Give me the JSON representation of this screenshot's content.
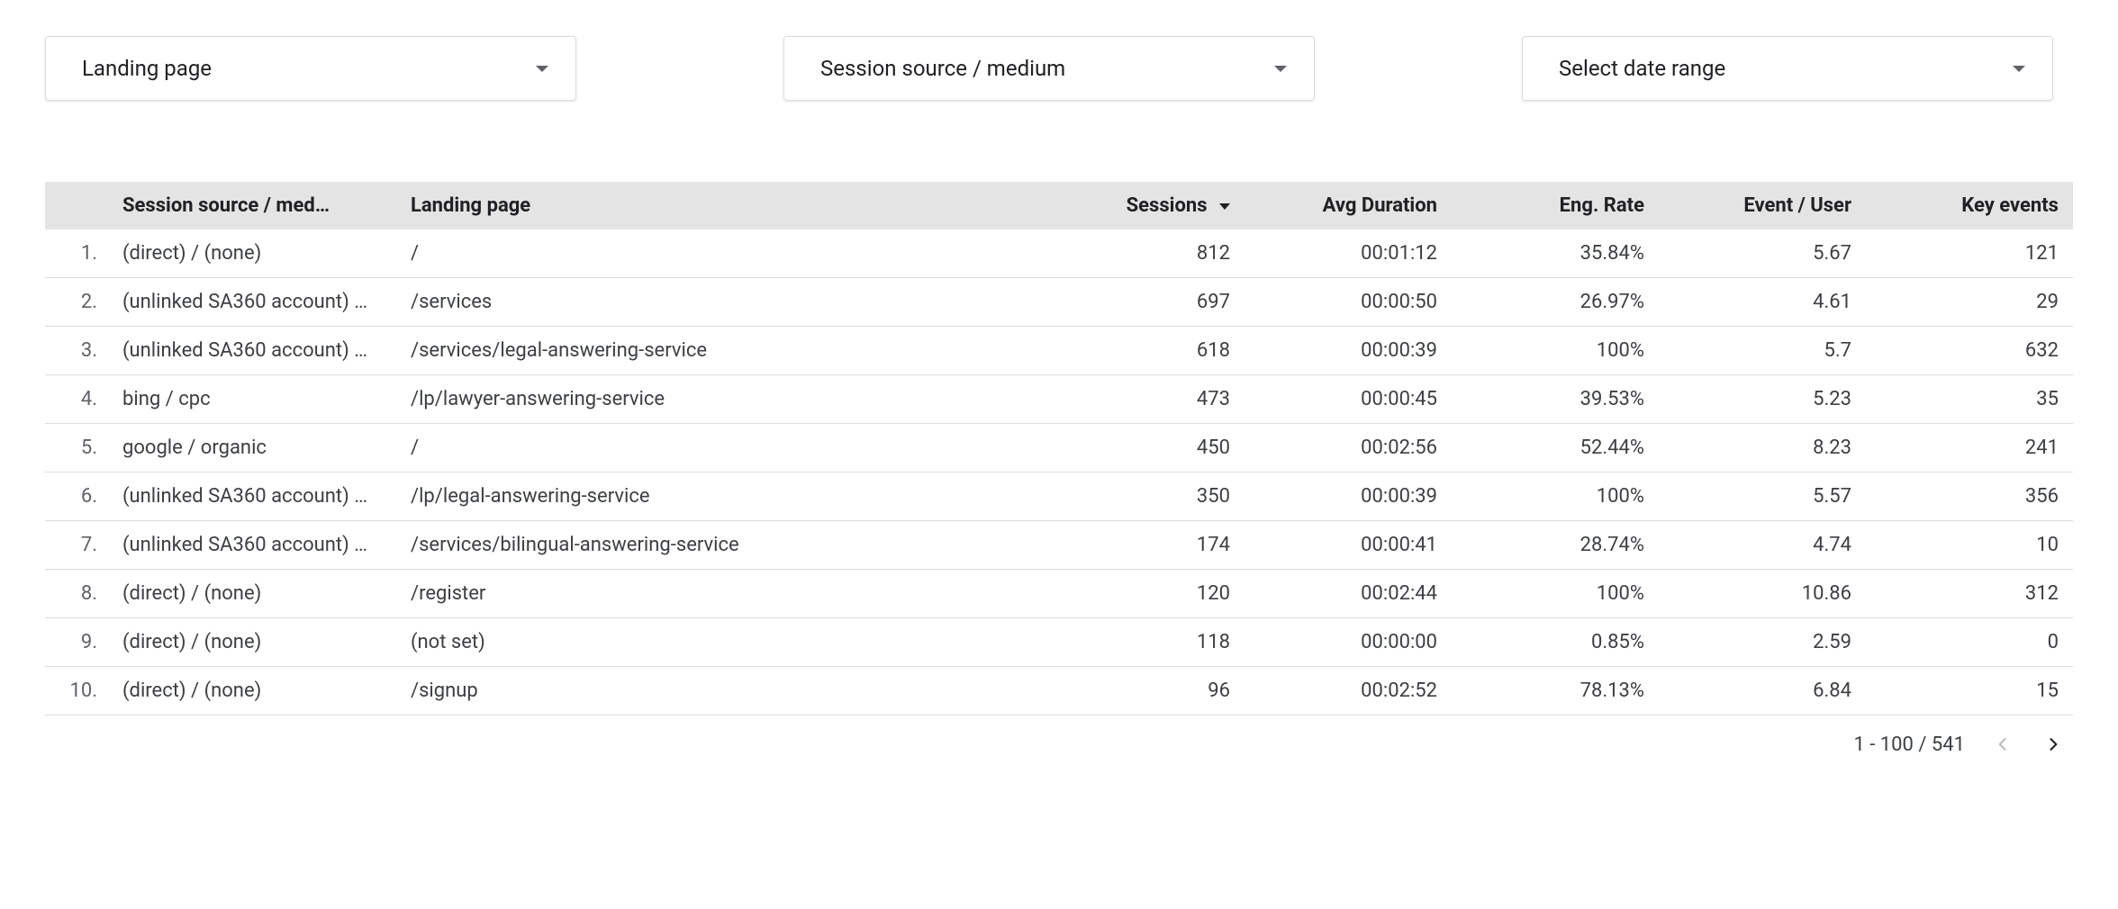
{
  "dropdowns": {
    "dimension1": "Landing page",
    "dimension2": "Session source / medium",
    "dateRange": "Select date range"
  },
  "table": {
    "headers": {
      "rowNum": "",
      "source": "Session source / med…",
      "landing": "Landing page",
      "sessions": "Sessions",
      "avgDuration": "Avg Duration",
      "engRate": "Eng. Rate",
      "eventUser": "Event / User",
      "keyEvents": "Key events"
    },
    "rows": [
      {
        "n": "1.",
        "source": "(direct) / (none)",
        "landing": "/",
        "sessions": "812",
        "avgDuration": "00:01:12",
        "engRate": "35.84%",
        "eventUser": "5.67",
        "keyEvents": "121"
      },
      {
        "n": "2.",
        "source": "(unlinked SA360 account) …",
        "landing": "/services",
        "sessions": "697",
        "avgDuration": "00:00:50",
        "engRate": "26.97%",
        "eventUser": "4.61",
        "keyEvents": "29"
      },
      {
        "n": "3.",
        "source": "(unlinked SA360 account) …",
        "landing": "/services/legal-answering-service",
        "sessions": "618",
        "avgDuration": "00:00:39",
        "engRate": "100%",
        "eventUser": "5.7",
        "keyEvents": "632"
      },
      {
        "n": "4.",
        "source": "bing / cpc",
        "landing": "/lp/lawyer-answering-service",
        "sessions": "473",
        "avgDuration": "00:00:45",
        "engRate": "39.53%",
        "eventUser": "5.23",
        "keyEvents": "35"
      },
      {
        "n": "5.",
        "source": "google / organic",
        "landing": "/",
        "sessions": "450",
        "avgDuration": "00:02:56",
        "engRate": "52.44%",
        "eventUser": "8.23",
        "keyEvents": "241"
      },
      {
        "n": "6.",
        "source": "(unlinked SA360 account) …",
        "landing": "/lp/legal-answering-service",
        "sessions": "350",
        "avgDuration": "00:00:39",
        "engRate": "100%",
        "eventUser": "5.57",
        "keyEvents": "356"
      },
      {
        "n": "7.",
        "source": "(unlinked SA360 account) …",
        "landing": "/services/bilingual-answering-service",
        "sessions": "174",
        "avgDuration": "00:00:41",
        "engRate": "28.74%",
        "eventUser": "4.74",
        "keyEvents": "10"
      },
      {
        "n": "8.",
        "source": "(direct) / (none)",
        "landing": "/register",
        "sessions": "120",
        "avgDuration": "00:02:44",
        "engRate": "100%",
        "eventUser": "10.86",
        "keyEvents": "312"
      },
      {
        "n": "9.",
        "source": "(direct) / (none)",
        "landing": "(not set)",
        "sessions": "118",
        "avgDuration": "00:00:00",
        "engRate": "0.85%",
        "eventUser": "2.59",
        "keyEvents": "0"
      },
      {
        "n": "10.",
        "source": "(direct) / (none)",
        "landing": "/signup",
        "sessions": "96",
        "avgDuration": "00:02:52",
        "engRate": "78.13%",
        "eventUser": "6.84",
        "keyEvents": "15"
      }
    ]
  },
  "pagination": {
    "rangeText": "1 - 100 / 541"
  }
}
